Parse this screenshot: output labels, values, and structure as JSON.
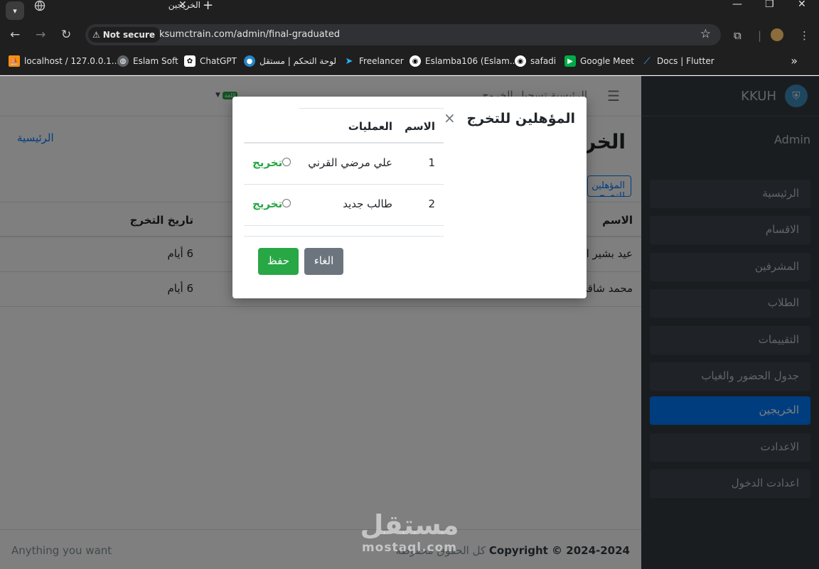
{
  "browser": {
    "tab_title": "الخريجين",
    "url": "ksumctrain.com/admin/final-graduated",
    "security_label": "Not secure",
    "bookmarks": [
      {
        "label": "localhost / 127.0.0.1...",
        "icon": "phpmyadmin-icon",
        "color": "#f29111"
      },
      {
        "label": "Eslam Soft",
        "icon": "globe-icon",
        "color": "#9aa0a6"
      },
      {
        "label": "ChatGPT",
        "icon": "chatgpt-icon",
        "color": "#ffffff"
      },
      {
        "label": "لوحة التحكم | مستقل",
        "icon": "mostaql-icon",
        "color": "#2386c8"
      },
      {
        "label": "Freelancer",
        "icon": "freelancer-icon",
        "color": "#29b2fe"
      },
      {
        "label": "Eslamba106 (Eslam...",
        "icon": "github-icon",
        "color": "#ffffff"
      },
      {
        "label": "safadi",
        "icon": "github-icon",
        "color": "#ffffff"
      },
      {
        "label": "Google Meet",
        "icon": "google-meet-icon",
        "color": "#00ac47"
      },
      {
        "label": "Docs | Flutter",
        "icon": "flutter-icon",
        "color": "#42a5f5"
      }
    ]
  },
  "app": {
    "brand": "KKUH",
    "user": "Admin",
    "sidebar": [
      {
        "label": "الرئيسية",
        "active": false
      },
      {
        "label": "الاقسام",
        "active": false
      },
      {
        "label": "المشرفين",
        "active": false
      },
      {
        "label": "الطلاب",
        "active": false
      },
      {
        "label": "التقييمات",
        "active": false
      },
      {
        "label": "جدول الحضور والغياب",
        "active": false
      },
      {
        "label": "الخريجين",
        "active": true
      },
      {
        "label": "الاعدادت",
        "active": false
      },
      {
        "label": "اعدادت الدخول",
        "active": false
      }
    ],
    "topbar_link": "الرئيسية تسجيل الخروج",
    "lang_badge": "اللغة",
    "page_title": "الخريجين",
    "breadcrumb_home": "الرئيسية",
    "qualified_button": "المؤهلين للتخرج",
    "graduates_table": {
      "headers": [
        "الاسم",
        "تاريخ التخرج"
      ],
      "rows": [
        [
          "عيد بشير المالكي",
          "6 أيام"
        ],
        [
          "محمد شاقي",
          "6 أيام"
        ]
      ]
    },
    "footer": {
      "left": "Anything you want",
      "copyright": "Copyright © 2024-2024",
      "rights": "كل الحقوق محفوظة"
    }
  },
  "modal": {
    "title": "المؤهلين للتخرج",
    "close": "×",
    "headers": [
      "الاسم",
      "العمليات"
    ],
    "rows": [
      {
        "index": "1",
        "name": "علي مرضي القرني",
        "action": "تخريج"
      },
      {
        "index": "2",
        "name": "طالب جديد",
        "action": "تخريج"
      }
    ],
    "save_label": "حفظ",
    "cancel_label": "الغاء"
  },
  "watermark": {
    "arabic": "مستقل",
    "latin": "mostaql.com"
  },
  "colors": {
    "accent": "#007bff",
    "success": "#28a745",
    "sidebar_bg": "#343a40",
    "secondary": "#6c757d"
  }
}
